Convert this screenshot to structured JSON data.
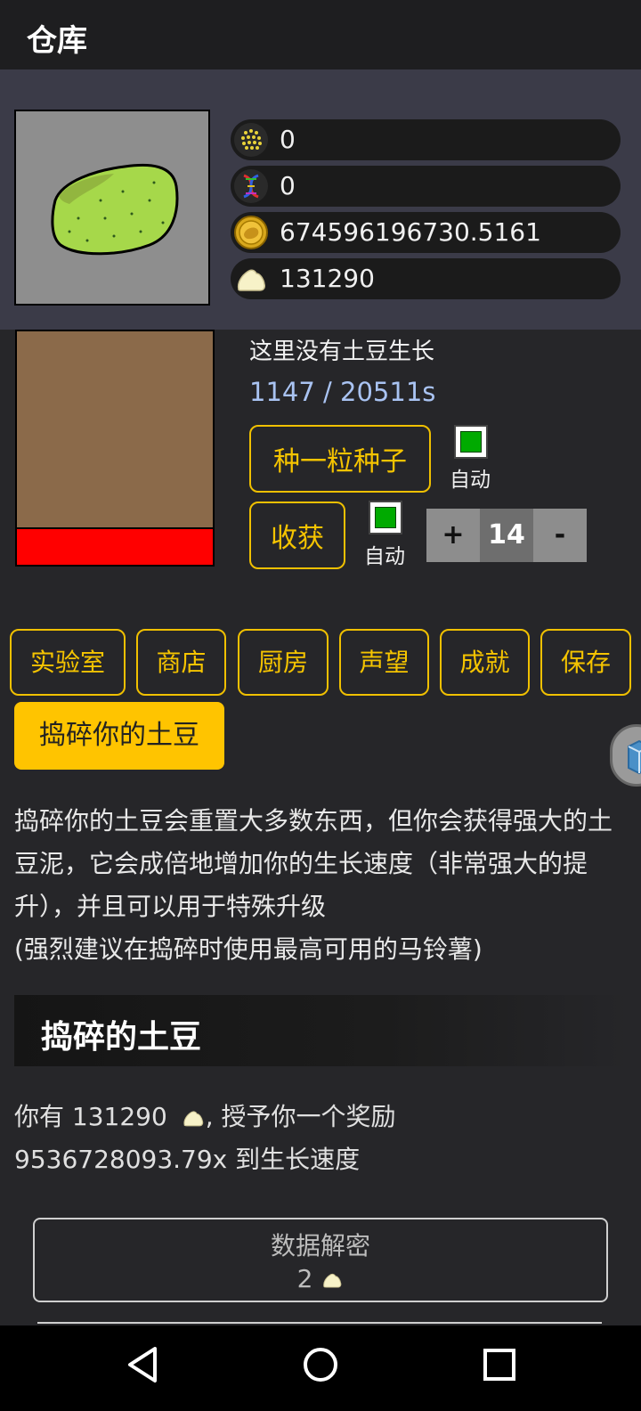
{
  "appbar": {
    "title": "仓库"
  },
  "resources": [
    {
      "icon": "seeds-icon",
      "value": "0"
    },
    {
      "icon": "dna-icon",
      "value": "0"
    },
    {
      "icon": "gold-coin-icon",
      "value": "674596196730.5161"
    },
    {
      "icon": "mashed-potato-icon",
      "value": "131290"
    }
  ],
  "plot": {
    "status": "这里没有土豆生长",
    "timer": "1147 / 20511s",
    "plant_label": "种一粒种子",
    "harvest_label": "收获",
    "auto_label_1": "自动",
    "auto_label_2": "自动",
    "plus": "+",
    "count": "14",
    "minus": "-"
  },
  "nav": {
    "lab": "实验室",
    "shop": "商店",
    "kitchen": "厨房",
    "prestige": "声望",
    "achievements": "成就",
    "save": "保存"
  },
  "mash": {
    "button": "捣碎你的土豆",
    "description_1": "捣碎你的土豆会重置大多数东西，但你会获得强大的土豆泥，它会成倍地增加你的生长速度（非常强大的提升），并且可以用于特殊升级",
    "description_2": "(强烈建议在捣碎时使用最高可用的马铃薯)",
    "section_title": "捣碎的土豆",
    "bonus_prefix": "你有 131290",
    "bonus_suffix": ", 授予你一个奖励",
    "bonus_line2": "9536728093.79x 到生长速度"
  },
  "upgrade": {
    "title": "数据解密",
    "cost": "2"
  },
  "colors": {
    "accent": "#f5c400",
    "soil": "#8b6a4a",
    "progress": "#ff0000",
    "auto_on": "#00aa00"
  }
}
